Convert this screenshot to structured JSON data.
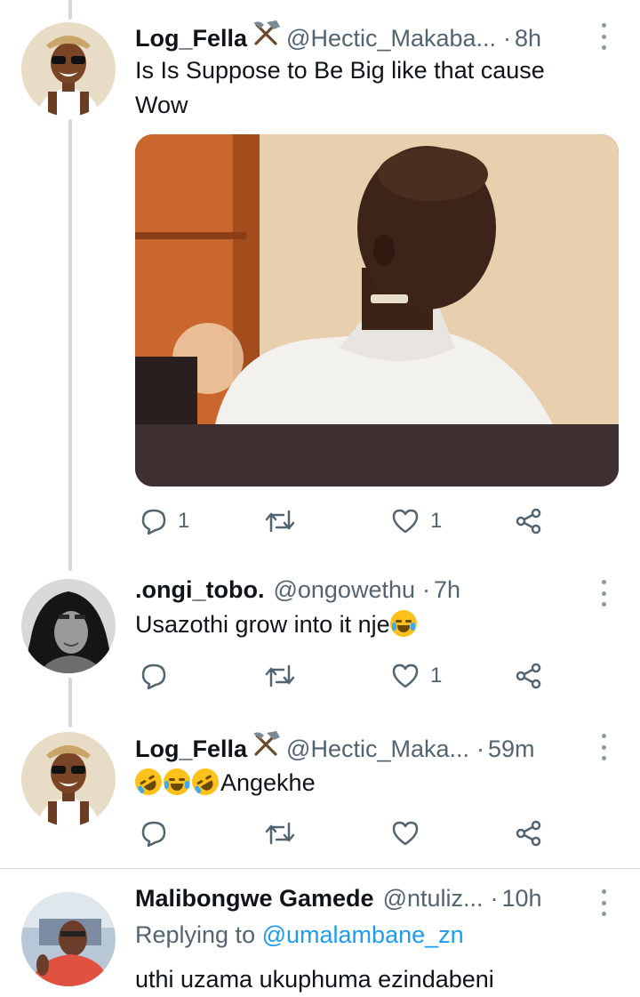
{
  "tweets": [
    {
      "name": "Log_Fella",
      "badge": "hammer-pick-icon",
      "handle": "@Hectic_Makaba...",
      "dot": "·",
      "time": "8h",
      "text_lines": [
        "Is Is Suppose to Be Big like that cause",
        "Wow"
      ],
      "media": "photo of a smiling bald man",
      "reply_count": "1",
      "retweet_count": "",
      "like_count": "1"
    },
    {
      "name": ".ongi_tobo.",
      "handle": "@ongowethu",
      "dot": "·",
      "time": "7h",
      "text": "Usazothi grow into it nje",
      "emojis": [
        "loudly-crying-face-emoji"
      ],
      "reply_count": "",
      "retweet_count": "",
      "like_count": "1"
    },
    {
      "name": "Log_Fella",
      "badge": "hammer-pick-icon",
      "handle": "@Hectic_Maka...",
      "dot": "·",
      "time": "59m",
      "emojis": [
        "rolling-on-floor-laughing-emoji",
        "face-with-tears-of-joy-emoji",
        "rolling-on-floor-laughing-emoji"
      ],
      "text": "Angekhe",
      "reply_count": "",
      "retweet_count": "",
      "like_count": ""
    },
    {
      "name": "Malibongwe Gamede",
      "handle": "@ntuliz...",
      "dot": "·",
      "time": "10h",
      "replying_prefix": "Replying to",
      "replying_to": "@umalambane_zn",
      "text": "uthi uzama ukuphuma ezindabeni"
    }
  ],
  "colors": {
    "accent": "#1d9bf0",
    "secondary_text": "#536471",
    "thread_line": "#cfd9de",
    "emoji_yellow": "#fcc21b"
  }
}
